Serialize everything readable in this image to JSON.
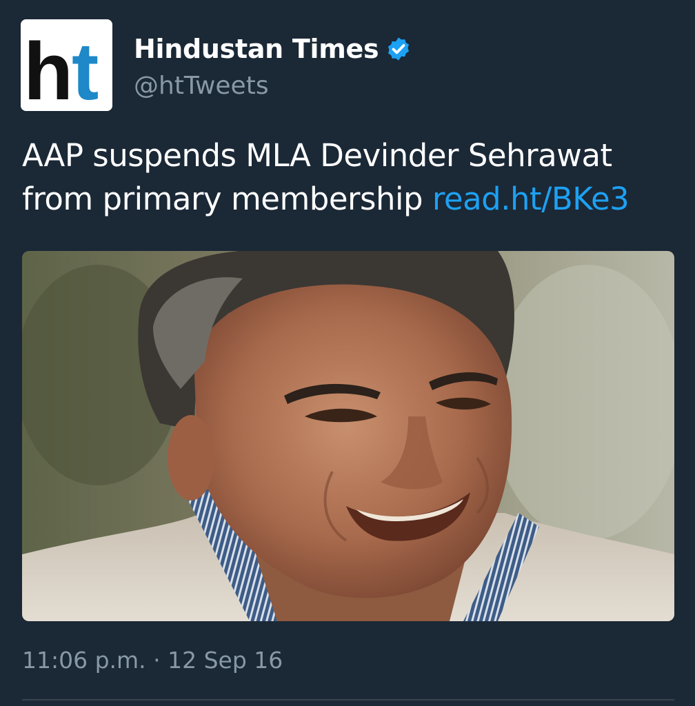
{
  "author": {
    "display_name": "Hindustan Times",
    "handle": "@htTweets",
    "verified": true,
    "logo_text_h": "h",
    "logo_text_t": "t"
  },
  "tweet": {
    "text": "AAP suspends MLA Devinder Sehrawat from primary membership ",
    "link": "read.ht/BKe3",
    "timestamp": "11:06 p.m. · 12 Sep 16"
  },
  "media": {
    "icon": "photo-of-smiling-man"
  },
  "colors": {
    "background": "#1b2836",
    "text": "#ffffff",
    "muted": "#8899a6",
    "link": "#1da1f2",
    "verified_badge": "#1da1f2",
    "logo_black": "#111111",
    "logo_blue": "#1e88c8"
  }
}
